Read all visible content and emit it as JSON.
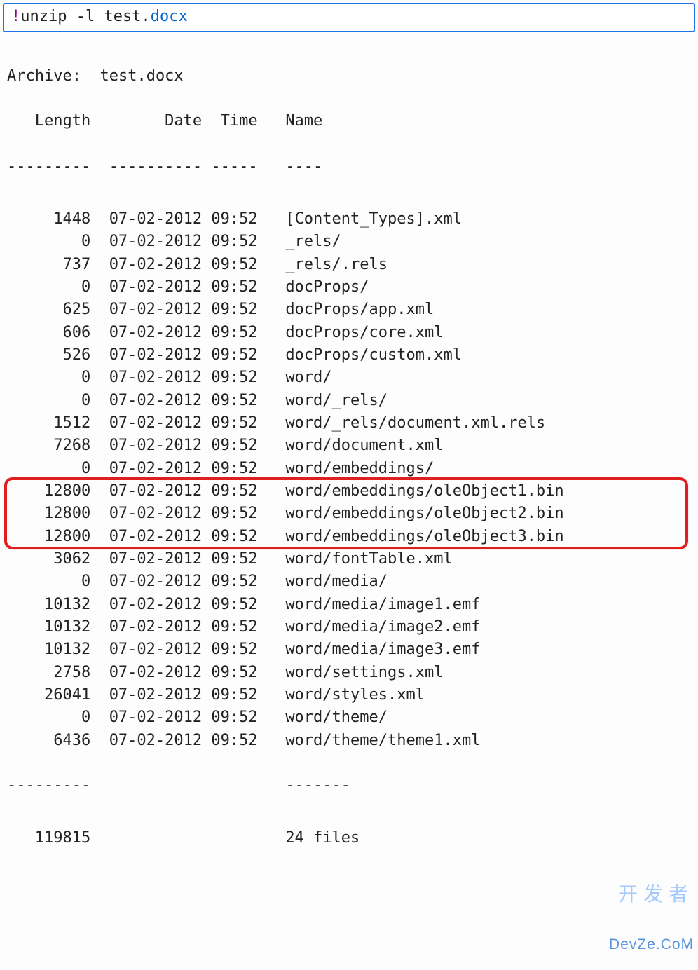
{
  "command": {
    "bang": "!",
    "cmd": "unzip",
    "flag": "-l",
    "arg_prefix": "test.",
    "arg_ext": "docx"
  },
  "archive_label": "Archive:",
  "archive_name": "test.docx",
  "headers": {
    "length": "Length",
    "date": "Date",
    "time": "Time",
    "name": "Name"
  },
  "dash": {
    "length": "---------",
    "date": "----------",
    "time": "-----",
    "name": "----",
    "footer_name": "-------"
  },
  "rows": [
    {
      "length": "1448",
      "date": "07-02-2012",
      "time": "09:52",
      "name": "[Content_Types].xml"
    },
    {
      "length": "0",
      "date": "07-02-2012",
      "time": "09:52",
      "name": "_rels/"
    },
    {
      "length": "737",
      "date": "07-02-2012",
      "time": "09:52",
      "name": "_rels/.rels"
    },
    {
      "length": "0",
      "date": "07-02-2012",
      "time": "09:52",
      "name": "docProps/"
    },
    {
      "length": "625",
      "date": "07-02-2012",
      "time": "09:52",
      "name": "docProps/app.xml"
    },
    {
      "length": "606",
      "date": "07-02-2012",
      "time": "09:52",
      "name": "docProps/core.xml"
    },
    {
      "length": "526",
      "date": "07-02-2012",
      "time": "09:52",
      "name": "docProps/custom.xml"
    },
    {
      "length": "0",
      "date": "07-02-2012",
      "time": "09:52",
      "name": "word/"
    },
    {
      "length": "0",
      "date": "07-02-2012",
      "time": "09:52",
      "name": "word/_rels/"
    },
    {
      "length": "1512",
      "date": "07-02-2012",
      "time": "09:52",
      "name": "word/_rels/document.xml.rels"
    },
    {
      "length": "7268",
      "date": "07-02-2012",
      "time": "09:52",
      "name": "word/document.xml"
    },
    {
      "length": "0",
      "date": "07-02-2012",
      "time": "09:52",
      "name": "word/embeddings/"
    },
    {
      "length": "12800",
      "date": "07-02-2012",
      "time": "09:52",
      "name": "word/embeddings/oleObject1.bin",
      "hl": true
    },
    {
      "length": "12800",
      "date": "07-02-2012",
      "time": "09:52",
      "name": "word/embeddings/oleObject2.bin",
      "hl": true
    },
    {
      "length": "12800",
      "date": "07-02-2012",
      "time": "09:52",
      "name": "word/embeddings/oleObject3.bin",
      "hl": true
    },
    {
      "length": "3062",
      "date": "07-02-2012",
      "time": "09:52",
      "name": "word/fontTable.xml"
    },
    {
      "length": "0",
      "date": "07-02-2012",
      "time": "09:52",
      "name": "word/media/"
    },
    {
      "length": "10132",
      "date": "07-02-2012",
      "time": "09:52",
      "name": "word/media/image1.emf"
    },
    {
      "length": "10132",
      "date": "07-02-2012",
      "time": "09:52",
      "name": "word/media/image2.emf"
    },
    {
      "length": "10132",
      "date": "07-02-2012",
      "time": "09:52",
      "name": "word/media/image3.emf"
    },
    {
      "length": "2758",
      "date": "07-02-2012",
      "time": "09:52",
      "name": "word/settings.xml"
    },
    {
      "length": "26041",
      "date": "07-02-2012",
      "time": "09:52",
      "name": "word/styles.xml"
    },
    {
      "length": "0",
      "date": "07-02-2012",
      "time": "09:52",
      "name": "word/theme/"
    },
    {
      "length": "6436",
      "date": "07-02-2012",
      "time": "09:52",
      "name": "word/theme/theme1.xml"
    }
  ],
  "footer": {
    "length": "119815",
    "name": "24 files"
  },
  "watermark": {
    "cn": "开发者",
    "en": "DevZe.CoM"
  }
}
